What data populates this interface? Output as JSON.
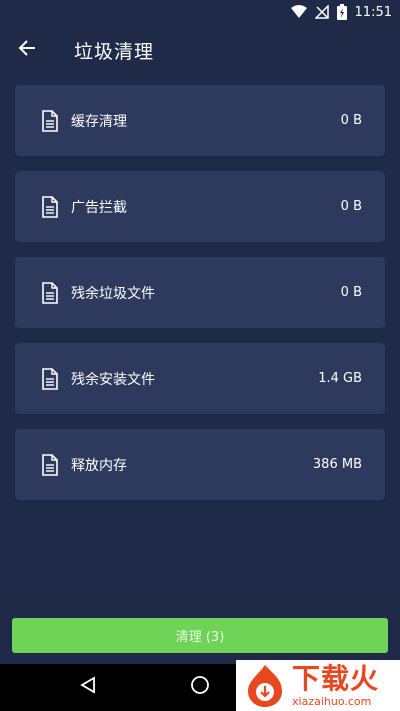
{
  "status_bar": {
    "time": "11:51"
  },
  "app_bar": {
    "title": "垃圾清理"
  },
  "items": [
    {
      "label": "缓存清理",
      "size": "0 B"
    },
    {
      "label": "广告拦截",
      "size": "0 B"
    },
    {
      "label": "残余垃圾文件",
      "size": "0 B"
    },
    {
      "label": "残余安装文件",
      "size": "1.4 GB"
    },
    {
      "label": "释放内存",
      "size": "386 MB"
    }
  ],
  "clean_button": {
    "label": "清理 (3)"
  },
  "watermark": {
    "cn": "下载火",
    "en": "xiazaihuo.com"
  },
  "colors": {
    "background": "#1e2a48",
    "card": "#2d3a5e",
    "accent_green": "#6ed356",
    "watermark_red": "#e8481f"
  }
}
